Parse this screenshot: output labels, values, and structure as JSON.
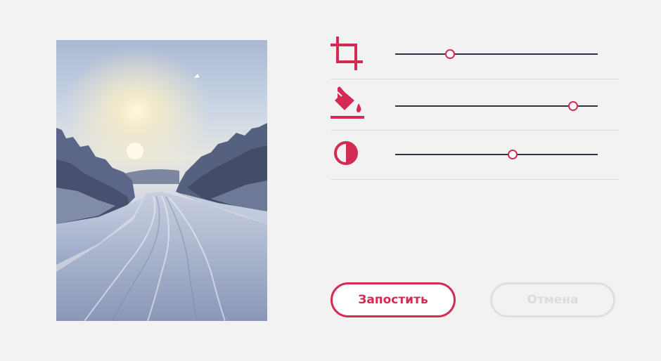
{
  "editor": {
    "image_alt": "Заснеженная дорога среди зимнего леса",
    "controls": [
      {
        "name": "crop",
        "icon": "crop-icon",
        "value": 0.27
      },
      {
        "name": "fill",
        "icon": "paint-bucket-icon",
        "value": 0.88
      },
      {
        "name": "contrast",
        "icon": "contrast-icon",
        "value": 0.58
      }
    ]
  },
  "actions": {
    "post_label": "Запостить",
    "cancel_label": "Отмена"
  },
  "colors": {
    "accent": "#d42b54",
    "track": "#2c3440",
    "background": "#f2f2f2",
    "disabled": "#dfdfdf"
  }
}
